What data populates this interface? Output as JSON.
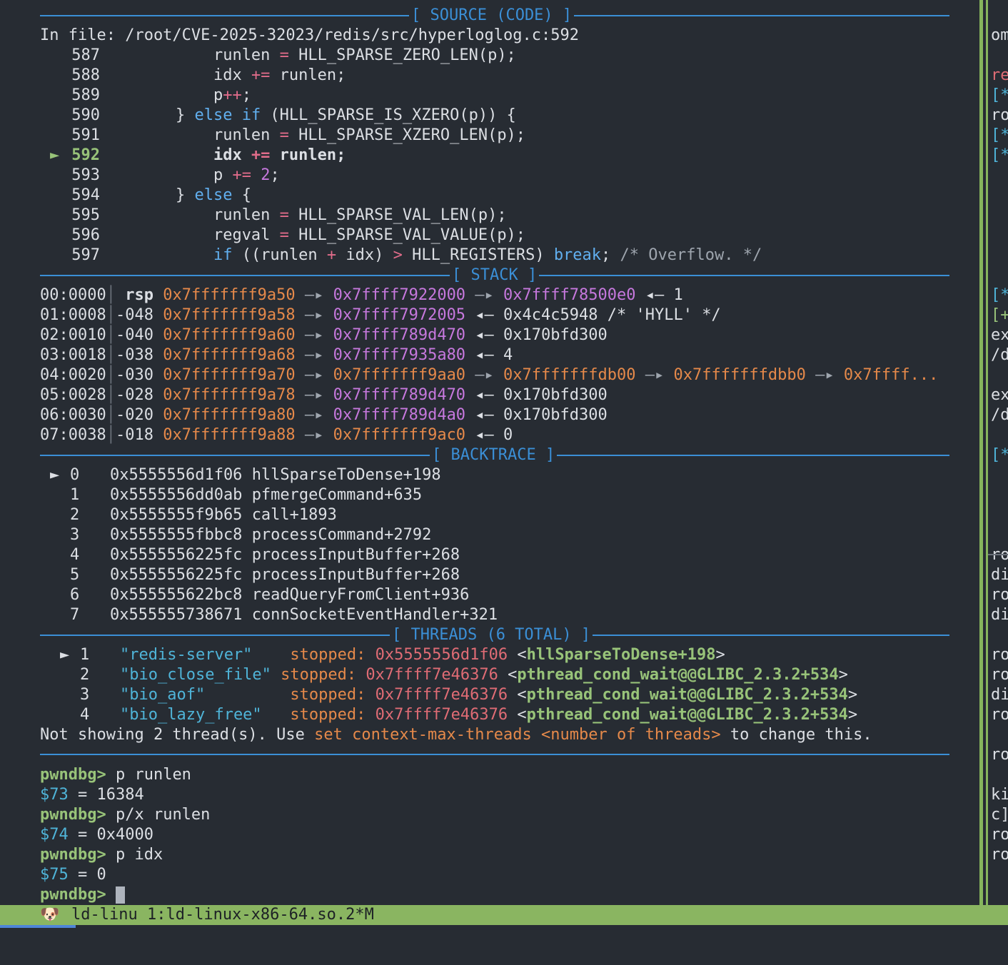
{
  "source": {
    "header": "[ SOURCE (CODE) ]",
    "file_line": "In file: /root/CVE-2025-32023/redis/src/hyperloglog.c:592",
    "current_marker": "►",
    "lines": [
      {
        "n": "587",
        "ind": "            ",
        "toks": [
          [
            "",
            "runlen "
          ],
          [
            "op",
            "="
          ],
          [
            "",
            " HLL_SPARSE_ZERO_LEN(p);"
          ]
        ]
      },
      {
        "n": "588",
        "ind": "            ",
        "toks": [
          [
            "",
            "idx "
          ],
          [
            "op",
            "+="
          ],
          [
            "",
            " runlen;"
          ]
        ]
      },
      {
        "n": "589",
        "ind": "            ",
        "toks": [
          [
            "",
            "p"
          ],
          [
            "op",
            "++"
          ],
          [
            "",
            ";"
          ]
        ]
      },
      {
        "n": "590",
        "ind": "        ",
        "toks": [
          [
            "",
            "} "
          ],
          [
            "kw",
            "else if"
          ],
          [
            "",
            " (HLL_SPARSE_IS_XZERO(p)) {"
          ]
        ]
      },
      {
        "n": "591",
        "ind": "            ",
        "toks": [
          [
            "",
            "runlen "
          ],
          [
            "op",
            "="
          ],
          [
            "",
            " HLL_SPARSE_XZERO_LEN(p);"
          ]
        ]
      },
      {
        "n": "592",
        "ind": "            ",
        "cur": true,
        "toks": [
          [
            "",
            "idx "
          ],
          [
            "op",
            "+="
          ],
          [
            "",
            " runlen;"
          ]
        ]
      },
      {
        "n": "593",
        "ind": "            ",
        "toks": [
          [
            "",
            "p "
          ],
          [
            "op",
            "+="
          ],
          [
            "",
            " "
          ],
          [
            "num",
            "2"
          ],
          [
            "",
            ";"
          ]
        ]
      },
      {
        "n": "594",
        "ind": "        ",
        "toks": [
          [
            "",
            "} "
          ],
          [
            "kw",
            "else"
          ],
          [
            "",
            " {"
          ]
        ]
      },
      {
        "n": "595",
        "ind": "            ",
        "toks": [
          [
            "",
            "runlen "
          ],
          [
            "op",
            "="
          ],
          [
            "",
            " HLL_SPARSE_VAL_LEN(p);"
          ]
        ]
      },
      {
        "n": "596",
        "ind": "            ",
        "toks": [
          [
            "",
            "regval "
          ],
          [
            "op",
            "="
          ],
          [
            "",
            " HLL_SPARSE_VAL_VALUE(p);"
          ]
        ]
      },
      {
        "n": "597",
        "ind": "            ",
        "toks": [
          [
            "kw",
            "if"
          ],
          [
            "",
            " ((runlen "
          ],
          [
            "op",
            "+"
          ],
          [
            "",
            " idx) "
          ],
          [
            "op",
            ">"
          ],
          [
            "",
            " HLL_REGISTERS) "
          ],
          [
            "kw",
            "break"
          ],
          [
            "",
            ";"
          ],
          [
            "cm",
            " /* Overflow. */"
          ]
        ]
      }
    ]
  },
  "stack": {
    "header": "[ STACK ]",
    "rows": [
      {
        "idx": "00:0000",
        "off": " rsp ",
        "bold": true,
        "toks": [
          [
            "orange",
            "0x7fffffff9a50"
          ],
          [
            "gray",
            " —▸ "
          ],
          [
            "purple",
            "0x7ffff7922000"
          ],
          [
            "gray",
            " —▸ "
          ],
          [
            "purple",
            "0x7ffff78500e0"
          ],
          [
            "",
            " ◂— 1"
          ]
        ]
      },
      {
        "idx": "01:0008",
        "off": "-048 ",
        "toks": [
          [
            "orange",
            "0x7fffffff9a58"
          ],
          [
            "gray",
            " —▸ "
          ],
          [
            "purple",
            "0x7ffff7972005"
          ],
          [
            "",
            " ◂— 0x4c4c5948 /* 'HYLL' */"
          ]
        ]
      },
      {
        "idx": "02:0010",
        "off": "-040 ",
        "toks": [
          [
            "orange",
            "0x7fffffff9a60"
          ],
          [
            "gray",
            " —▸ "
          ],
          [
            "purple",
            "0x7ffff789d470"
          ],
          [
            "",
            " ◂— 0x170bfd300"
          ]
        ]
      },
      {
        "idx": "03:0018",
        "off": "-038 ",
        "toks": [
          [
            "orange",
            "0x7fffffff9a68"
          ],
          [
            "gray",
            " —▸ "
          ],
          [
            "purple",
            "0x7ffff7935a80"
          ],
          [
            "",
            " ◂— 4"
          ]
        ]
      },
      {
        "idx": "04:0020",
        "off": "-030 ",
        "toks": [
          [
            "orange",
            "0x7fffffff9a70"
          ],
          [
            "gray",
            " —▸ "
          ],
          [
            "orange",
            "0x7fffffff9aa0"
          ],
          [
            "gray",
            " —▸ "
          ],
          [
            "orange",
            "0x7fffffffdb00"
          ],
          [
            "gray",
            " —▸ "
          ],
          [
            "orange",
            "0x7fffffffdbb0"
          ],
          [
            "gray",
            " —▸ "
          ],
          [
            "orange",
            "0x7ffff..."
          ]
        ]
      },
      {
        "idx": "05:0028",
        "off": "-028 ",
        "toks": [
          [
            "orange",
            "0x7fffffff9a78"
          ],
          [
            "gray",
            " —▸ "
          ],
          [
            "purple",
            "0x7ffff789d470"
          ],
          [
            "",
            " ◂— 0x170bfd300"
          ]
        ]
      },
      {
        "idx": "06:0030",
        "off": "-020 ",
        "toks": [
          [
            "orange",
            "0x7fffffff9a80"
          ],
          [
            "gray",
            " —▸ "
          ],
          [
            "purple",
            "0x7ffff789d4a0"
          ],
          [
            "",
            " ◂— 0x170bfd300"
          ]
        ]
      },
      {
        "idx": "07:0038",
        "off": "-018 ",
        "toks": [
          [
            "orange",
            "0x7fffffff9a88"
          ],
          [
            "gray",
            " —▸ "
          ],
          [
            "orange",
            "0x7fffffff9ac0"
          ],
          [
            "",
            " ◂— 0"
          ]
        ]
      }
    ]
  },
  "backtrace": {
    "header": "[ BACKTRACE ]",
    "rows": [
      {
        "m": "►",
        "n": "0",
        "addr": "0x5555556d1f06",
        "sym": "hllSparseToDense+198"
      },
      {
        "m": "",
        "n": "1",
        "addr": "0x5555556dd0ab",
        "sym": "pfmergeCommand+635"
      },
      {
        "m": "",
        "n": "2",
        "addr": "0x5555555f9b65",
        "sym": "call+1893"
      },
      {
        "m": "",
        "n": "3",
        "addr": "0x5555555fbbc8",
        "sym": "processCommand+2792"
      },
      {
        "m": "",
        "n": "4",
        "addr": "0x5555556225fc",
        "sym": "processInputBuffer+268"
      },
      {
        "m": "",
        "n": "5",
        "addr": "0x5555556225fc",
        "sym": "processInputBuffer+268"
      },
      {
        "m": "",
        "n": "6",
        "addr": "0x555555622bc8",
        "sym": "readQueryFromClient+936"
      },
      {
        "m": "",
        "n": "7",
        "addr": "0x555555738671",
        "sym": "connSocketEventHandler+321"
      }
    ]
  },
  "threads": {
    "header": "[ THREADS (6 TOTAL) ]",
    "rows": [
      {
        "m": "►",
        "n": "1",
        "name": "\"redis-server\"   ",
        "state": "stopped:",
        "addr": "0x5555556d1f06",
        "sym": "hllSparseToDense+198"
      },
      {
        "m": "",
        "n": "2",
        "name": "\"bio_close_file\"",
        "state": "stopped:",
        "addr": "0x7ffff7e46376",
        "sym": "pthread_cond_wait@@GLIBC_2.3.2+534"
      },
      {
        "m": "",
        "n": "3",
        "name": "\"bio_aof\"        ",
        "state": "stopped:",
        "addr": "0x7ffff7e46376",
        "sym": "pthread_cond_wait@@GLIBC_2.3.2+534"
      },
      {
        "m": "",
        "n": "4",
        "name": "\"bio_lazy_free\"  ",
        "state": "stopped:",
        "addr": "0x7ffff7e46376",
        "sym": "pthread_cond_wait@@GLIBC_2.3.2+534"
      }
    ],
    "note_pre": "Not showing 2 thread(s). Use ",
    "note_cmd": "set context-max-threads <number of threads>",
    "note_post": " to change this."
  },
  "console": {
    "prompt": "pwndbg> ",
    "lines": [
      {
        "type": "cmd",
        "text": "p runlen"
      },
      {
        "type": "out",
        "var": "$73",
        "rest": " = 16384"
      },
      {
        "type": "cmd",
        "text": "p/x runlen"
      },
      {
        "type": "out",
        "var": "$74",
        "rest": " = 0x4000"
      },
      {
        "type": "cmd",
        "text": "p idx"
      },
      {
        "type": "out",
        "var": "$75",
        "rest": " = 0"
      },
      {
        "type": "cmd",
        "text": "",
        "cursor": true
      }
    ]
  },
  "right_pane": [
    {
      "row": 2,
      "text": "om",
      "color": "#dcdfe4"
    },
    {
      "row": 4,
      "text": "re",
      "color": "#e06c75"
    },
    {
      "row": 5,
      "text": "[*",
      "color": "#4fb4d8"
    },
    {
      "row": 6,
      "text": "ro",
      "color": "#dcdfe4"
    },
    {
      "row": 7,
      "text": "[*",
      "color": "#4fb4d8"
    },
    {
      "row": 8,
      "text": "[*",
      "color": "#4fb4d8"
    },
    {
      "row": 15,
      "text": "[*",
      "color": "#4fb4d8"
    },
    {
      "row": 16,
      "text": "[+",
      "color": "#98c379"
    },
    {
      "row": 17,
      "text": "ex",
      "color": "#dcdfe4"
    },
    {
      "row": 18,
      "text": "/d",
      "color": "#dcdfe4"
    },
    {
      "row": 20,
      "text": "ex",
      "color": "#dcdfe4"
    },
    {
      "row": 21,
      "text": "/d",
      "color": "#dcdfe4"
    },
    {
      "row": 23,
      "text": "[*",
      "color": "#4fb4d8"
    },
    {
      "row": 28,
      "text": "ro",
      "color": "#dcdfe4"
    },
    {
      "row": 29,
      "text": "di",
      "color": "#dcdfe4"
    },
    {
      "row": 30,
      "text": "ro",
      "color": "#dcdfe4"
    },
    {
      "row": 31,
      "text": "di",
      "color": "#dcdfe4"
    },
    {
      "row": 33,
      "text": "ro",
      "color": "#dcdfe4"
    },
    {
      "row": 34,
      "text": "ro",
      "color": "#dcdfe4"
    },
    {
      "row": 35,
      "text": "di",
      "color": "#dcdfe4"
    },
    {
      "row": 36,
      "text": "ro",
      "color": "#dcdfe4"
    },
    {
      "row": 38,
      "text": "ro",
      "color": "#dcdfe4"
    },
    {
      "row": 40,
      "text": "ki",
      "color": "#dcdfe4"
    },
    {
      "row": 41,
      "text": "c]",
      "color": "#dcdfe4"
    },
    {
      "row": 42,
      "text": "ro",
      "color": "#dcdfe4"
    },
    {
      "row": 43,
      "text": "ro",
      "color": "#dcdfe4"
    }
  ],
  "status_bar": {
    "icon": "🐶",
    "text": "ld-linu 1:ld-linux-x86-64.so.2*M"
  }
}
